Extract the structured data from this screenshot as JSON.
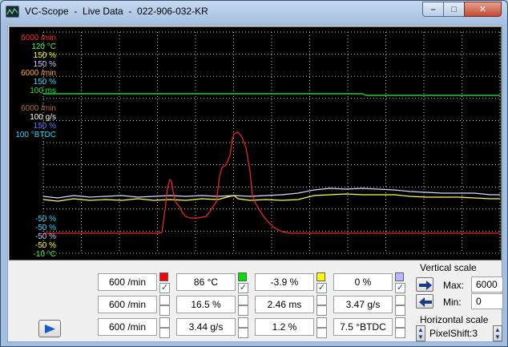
{
  "window": {
    "title": "VC-Scope  -  Live Data  -  022-906-032-KR",
    "minimize_glyph": "–",
    "maximize_glyph": "□",
    "close_glyph": "✕"
  },
  "scope": {
    "background": "#000000",
    "grid_color": "#c8c8c8",
    "upper_labels": [
      {
        "text": "6000 /min",
        "color": "#ff2a2a"
      },
      {
        "text": "120 °C",
        "color": "#3cff3c"
      },
      {
        "text": "150 %",
        "color": "#ffff2a"
      },
      {
        "text": "150 %",
        "color": "#c8c8ff"
      },
      {
        "text": "6000 /min",
        "color": "#ffaa2a"
      },
      {
        "text": "150 %",
        "color": "#2ad7ff"
      },
      {
        "text": "100 ms",
        "color": "#2ae62a"
      },
      {
        "text": "",
        "color": "#2a2aff"
      },
      {
        "text": "6000 /min",
        "color": "#b07040"
      },
      {
        "text": "100 g/s",
        "color": "#ffffff"
      },
      {
        "text": "150 %",
        "color": "#5a7aff"
      },
      {
        "text": "100 °BTDC",
        "color": "#2ad7ff"
      }
    ],
    "lower_labels": [
      {
        "text": "-50 %",
        "color": "#2ad7ff"
      },
      {
        "text": "-50 %",
        "color": "#2ad7ff"
      },
      {
        "text": "-50 %",
        "color": "#c8c8ff"
      },
      {
        "text": "-50 %",
        "color": "#ffff2a"
      },
      {
        "text": "-10 °C",
        "color": "#3cff3c"
      }
    ]
  },
  "channels": [
    {
      "value": "600 /min",
      "color": "#ff0000",
      "checked": true
    },
    {
      "value": "86 °C",
      "color": "#00e000",
      "checked": true
    },
    {
      "value": "-3.9 %",
      "color": "#ffff00",
      "checked": true
    },
    {
      "value": "0 %",
      "color": "#b8b8ff",
      "checked": true
    },
    {
      "value": "600 /min",
      "color": "",
      "checked": false
    },
    {
      "value": "16.5 %",
      "color": "",
      "checked": false
    },
    {
      "value": "2.46 ms",
      "color": "",
      "checked": false
    },
    {
      "value": "3.47 g/s",
      "color": "",
      "checked": false
    },
    {
      "value": "600 /min",
      "color": "",
      "checked": false
    },
    {
      "value": "3.44 g/s",
      "color": "",
      "checked": false
    },
    {
      "value": "1.2 %",
      "color": "",
      "checked": false
    },
    {
      "value": "7.5 °BTDC",
      "color": "",
      "checked": false
    }
  ],
  "vertical_scale": {
    "title": "Vertical scale",
    "max_label": "Max:",
    "max_value": "6000",
    "min_label": "Min:",
    "min_value": "0"
  },
  "horizontal_scale": {
    "title": "Horizontal scale",
    "value": "PixelShift:3"
  },
  "check_glyph": "✓"
}
